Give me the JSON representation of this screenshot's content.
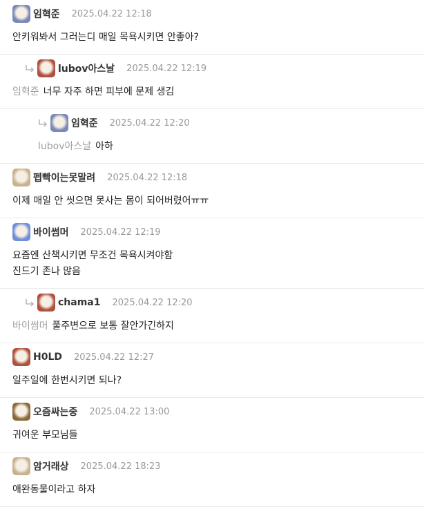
{
  "comments": [
    {
      "level": 0,
      "avatar": "avatar-icon",
      "avatar_color": "#7a88b8",
      "nick": "임혁준",
      "date": "2025.04.22 12:18",
      "mention": "",
      "text": "안키워봐서 그러는디 매일 목욕시키면 안좋아?"
    },
    {
      "level": 1,
      "avatar": "avatar-icon",
      "avatar_color": "#b0503f",
      "nick": "lubov아스날",
      "date": "2025.04.22 12:19",
      "mention": "임혁준",
      "text": "너무 자주 하면 피부에 문제 생김"
    },
    {
      "level": 2,
      "avatar": "avatar-icon",
      "avatar_color": "#7a88b8",
      "nick": "임혁준",
      "date": "2025.04.22 12:20",
      "mention": "lubov아스날",
      "text": "아하"
    },
    {
      "level": 0,
      "avatar": "avatar-icon",
      "avatar_color": "#c9b38e",
      "nick": "펩빡이는못말려",
      "date": "2025.04.22 12:18",
      "mention": "",
      "text": "이제 매일 안 씻으면 못사는 몸이 되어버렸어ㅠㅠ"
    },
    {
      "level": 0,
      "avatar": "avatar-icon",
      "avatar_color": "#6f8fd8",
      "nick": "바이썸머",
      "date": "2025.04.22 12:19",
      "mention": "",
      "text": "요즘엔 산책시키면 무조건 목욕시켜야함\n진드기 존나 많음"
    },
    {
      "level": 1,
      "avatar": "avatar-icon",
      "avatar_color": "#b0503f",
      "nick": "chama1",
      "date": "2025.04.22 12:20",
      "mention": "바이썸머",
      "text": "풀주변으로 보통 잘안가긴하지"
    },
    {
      "level": 0,
      "avatar": "avatar-icon",
      "avatar_color": "#b0503f",
      "nick": "H0LD",
      "date": "2025.04.22 12:27",
      "mention": "",
      "text": "일주일에 한번시키면 되나?"
    },
    {
      "level": 0,
      "avatar": "avatar-icon",
      "avatar_color": "#8a6a3a",
      "nick": "오즘싸는중",
      "date": "2025.04.22 13:00",
      "mention": "",
      "text": "귀여운 부모님들"
    },
    {
      "level": 0,
      "avatar": "avatar-icon",
      "avatar_color": "#c9b38e",
      "nick": "암거래상",
      "date": "2025.04.22 18:23",
      "mention": "",
      "text": "애완동물이라고 하자"
    }
  ]
}
